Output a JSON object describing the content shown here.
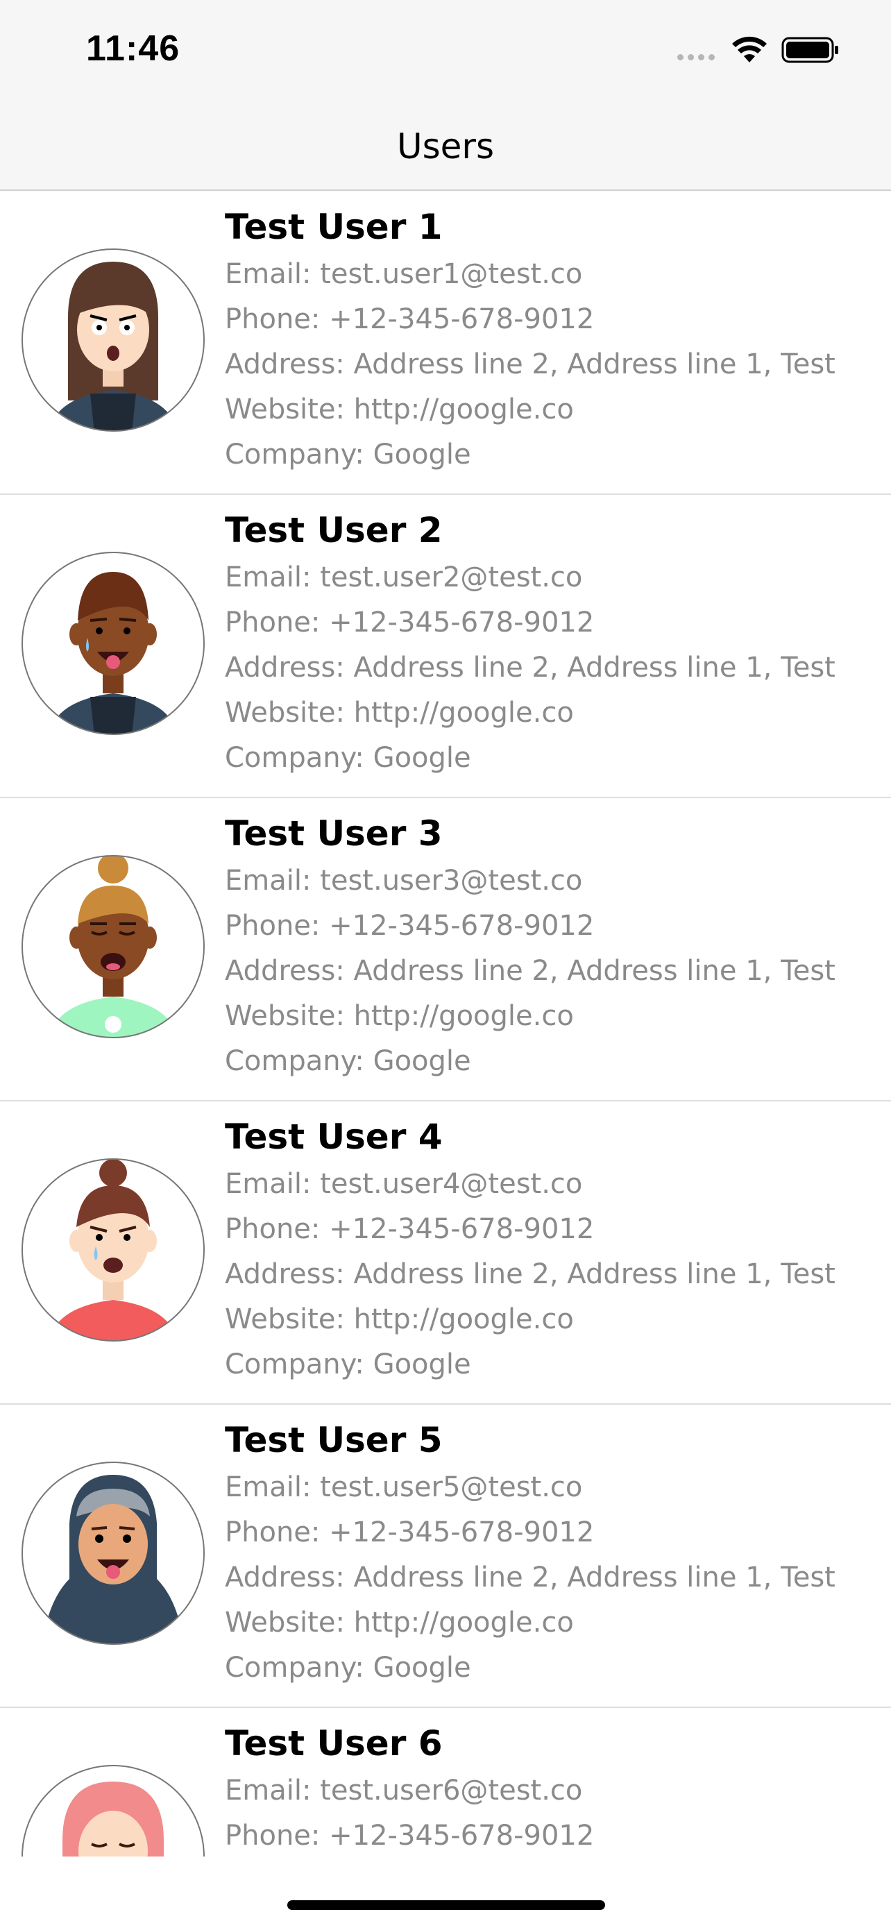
{
  "status_bar": {
    "time": "11:46"
  },
  "nav": {
    "title": "Users"
  },
  "users": [
    {
      "name": "Test User 1",
      "email": "Email: test.user1@test.co",
      "phone": "Phone: +12-345-678-9012",
      "address": "Address: Address line 2, Address line 1, Test",
      "website": "Website: http://google.co",
      "company": "Company: Google"
    },
    {
      "name": "Test User 2",
      "email": "Email: test.user2@test.co",
      "phone": "Phone: +12-345-678-9012",
      "address": "Address: Address line 2, Address line 1, Test",
      "website": "Website: http://google.co",
      "company": "Company: Google"
    },
    {
      "name": "Test User 3",
      "email": "Email: test.user3@test.co",
      "phone": "Phone: +12-345-678-9012",
      "address": "Address: Address line 2, Address line 1, Test",
      "website": "Website: http://google.co",
      "company": "Company: Google"
    },
    {
      "name": "Test User 4",
      "email": "Email: test.user4@test.co",
      "phone": "Phone: +12-345-678-9012",
      "address": "Address: Address line 2, Address line 1, Test",
      "website": "Website: http://google.co",
      "company": "Company: Google"
    },
    {
      "name": "Test User 5",
      "email": "Email: test.user5@test.co",
      "phone": "Phone: +12-345-678-9012",
      "address": "Address: Address line 2, Address line 1, Test",
      "website": "Website: http://google.co",
      "company": "Company: Google"
    },
    {
      "name": "Test User 6",
      "email": "Email: test.user6@test.co",
      "phone": "Phone: +12-345-678-9012"
    }
  ],
  "icons": {
    "wifi": "wifi-icon",
    "battery": "battery-icon",
    "signal": "cellular-signal-icon",
    "avatar": "user-avatar-illustration"
  },
  "colors": {
    "bar_background": "#f6f6f6",
    "secondary_text": "#8a8a8a",
    "separator": "#dedede"
  }
}
